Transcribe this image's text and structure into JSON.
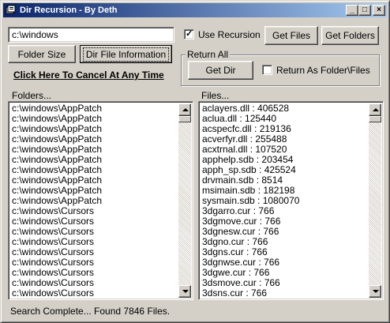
{
  "window": {
    "title": "Dir Recursion - By Deth",
    "minimize_glyph": "_",
    "maximize_glyph": "□",
    "close_glyph": "×"
  },
  "path_input": {
    "value": "c:\\windows"
  },
  "use_recursion": {
    "label": "Use Recursion",
    "checked": true
  },
  "buttons": {
    "get_files": "Get Files",
    "get_folders": "Get Folders",
    "folder_size": "Folder Size",
    "dir_file_info": "Dir File Information",
    "get_dir": "Get Dir"
  },
  "cancel_link": "Click Here To Cancel At Any Time",
  "return_all": {
    "legend": "Return All",
    "return_as_label": "Return As Folder\\Files",
    "return_as_checked": false
  },
  "folders": {
    "label": "Folders...",
    "items": [
      "c:\\windows\\AppPatch",
      "c:\\windows\\AppPatch",
      "c:\\windows\\AppPatch",
      "c:\\windows\\AppPatch",
      "c:\\windows\\AppPatch",
      "c:\\windows\\AppPatch",
      "c:\\windows\\AppPatch",
      "c:\\windows\\AppPatch",
      "c:\\windows\\AppPatch",
      "c:\\windows\\AppPatch",
      "c:\\windows\\Cursors",
      "c:\\windows\\Cursors",
      "c:\\windows\\Cursors",
      "c:\\windows\\Cursors",
      "c:\\windows\\Cursors",
      "c:\\windows\\Cursors",
      "c:\\windows\\Cursors",
      "c:\\windows\\Cursors",
      "c:\\windows\\Cursors",
      "c:\\windows\\Cursors"
    ]
  },
  "files": {
    "label": "Files...",
    "items": [
      "aclayers.dll : 406528",
      "aclua.dll : 125440",
      "acspecfc.dll : 219136",
      "acverfyr.dll : 255488",
      "acxtrnal.dll : 107520",
      "apphelp.sdb : 203454",
      "apph_sp.sdb : 425524",
      "drvmain.sdb : 8514",
      "msimain.sdb : 182198",
      "sysmain.sdb : 1080070",
      "3dgarro.cur : 766",
      "3dgmove.cur : 766",
      "3dgnesw.cur : 766",
      "3dgno.cur : 766",
      "3dgns.cur : 766",
      "3dgnwse.cur : 766",
      "3dgwe.cur : 766",
      "3dsmove.cur : 766",
      "3dsns.cur : 766"
    ]
  },
  "status": "Search Complete... Found 7846 Files."
}
